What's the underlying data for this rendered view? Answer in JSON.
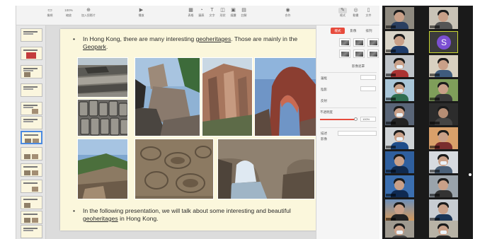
{
  "toolbar": {
    "view_label": "檢視",
    "zoom_value": "100%",
    "zoom_label": "縮放",
    "add_slide_label": "加入投影片",
    "play_label": "播放",
    "table_label": "表格",
    "chart_label": "圖表",
    "text_label": "文字",
    "shape_label": "形狀",
    "media_label": "媒體",
    "comment_label": "註解",
    "collaborate_label": "合作",
    "format_label": "格式",
    "animate_label": "動畫",
    "document_label": "文件"
  },
  "navigator": {
    "slide_count_visible": 14,
    "selected_index": 6
  },
  "slide": {
    "bullet1_prefix": "In Hong Kong, there are many interesting ",
    "bullet1_link": "geoheritages",
    "bullet1_mid": ". Those are mainly in the ",
    "bullet1_link2": "Geopark",
    "bullet1_end": ".",
    "bullet2_prefix": "In the following presentation, we will talk about some interesting and beautiful ",
    "bullet2_link": "geoheritages",
    "bullet2_end": " in Hong Kong."
  },
  "inspector": {
    "tabs": [
      "樣式",
      "影像",
      "排列"
    ],
    "active_tab": 0,
    "edit_mask_label": "影像遮罩",
    "border_label": "邊框",
    "shadow_label": "陰影",
    "reflection_label": "反射",
    "opacity_label": "不透明度",
    "opacity_value": "100%",
    "accessibility_label": "描述",
    "description_label": "影像"
  },
  "colors": {
    "slide_bg": "#fbf7dc",
    "accent_red": "#e74b3c",
    "selection_blue": "#4b8ae0",
    "active_speaker_border": "#c9d832",
    "avatar_purple": "#7b4fd2"
  },
  "gallery": {
    "tile_count": 20,
    "s_avatar_letter": "S"
  }
}
